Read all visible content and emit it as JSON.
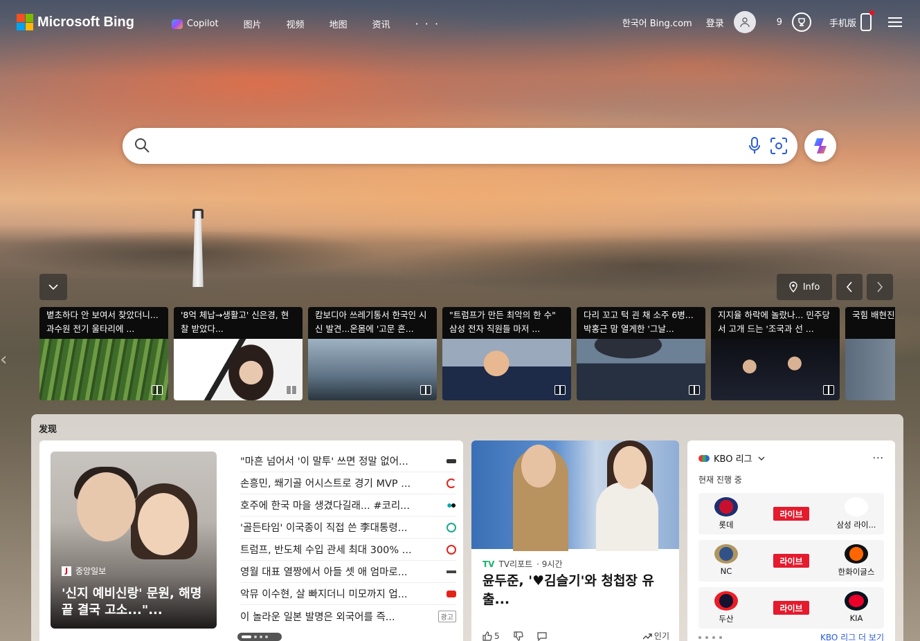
{
  "header": {
    "logo_text": "Microsoft Bing",
    "nav": [
      {
        "label": "Copilot"
      },
      {
        "label": "图片"
      },
      {
        "label": "视频"
      },
      {
        "label": "地图"
      },
      {
        "label": "资讯"
      },
      {
        "label": "· · ·"
      }
    ],
    "region_link": "한국어 Bing.com",
    "login": "登录",
    "reward_count": "9",
    "mobile": "手机版"
  },
  "search": {
    "value": "",
    "placeholder": ""
  },
  "carousel": {
    "info_label": "Info",
    "items": [
      {
        "title": "볕초하다 안 보여서 찾았더니... 과수원 전기 울타리에 ..."
      },
      {
        "title": "'8억 체납→생활고' 신은경, 현찰 받았다..."
      },
      {
        "title": "캄보디아 쓰레기통서 한국인 시신 발견...온몸에 '고문 흔..."
      },
      {
        "title": "\"트럼프가 만든 최악의 한 수\" 삼성 전자 직원들 마저 ..."
      },
      {
        "title": "다리 꼬고 턱 괸 채 소주 6병...박홍근 맘 열게한 '그날..."
      },
      {
        "title": "지지율 하락에 놀랐나... 민주당서 고개 드는 '조국과 선 ..."
      },
      {
        "title": "국힘 배현진 개두술 받아"
      }
    ]
  },
  "discover": {
    "label": "发现",
    "hero": {
      "source": "중앙일보",
      "title": "'신지 예비신랑' 문원, 해명 끝 결국 고소...\"..."
    },
    "headlines": [
      {
        "text": "\"마흔 넘어서 '이 말투' 쓰면 정말 없어..."
      },
      {
        "text": "손흥민, 쐐기골 어시스트로 경기 MVP ..."
      },
      {
        "text": "호주에 한국 마을 생겼다길래... #코리..."
      },
      {
        "text": "'골든타임' 이국종이 직접 쓴 李대통령..."
      },
      {
        "text": "트럼프, 반도체 수입 관세 최대 300% ..."
      },
      {
        "text": "영월 대표 열짱에서 아들 셋 애 엄마로..."
      },
      {
        "text": "악뮤 이수현, 살 빠지더니 미모까지 업..."
      },
      {
        "text": "이 놀라운 일본 발명은 외국어를 즉...",
        "ad": "광고"
      }
    ],
    "feature": {
      "source": "TV리포트",
      "time": "· 9시간",
      "title": "윤두준, '♥김슬기'와 청첩장 유출...",
      "likes": "5",
      "trend": "인기"
    },
    "kbo": {
      "title": "KBO 리그",
      "status": "현재 진행 중",
      "live_label": "라이브",
      "games": [
        {
          "home": "롯데",
          "away": "삼성 라이..."
        },
        {
          "home": "NC",
          "away": "한화이글스"
        },
        {
          "home": "두산",
          "away": "KIA"
        }
      ],
      "more_link": "KBO 리그 더 보기"
    }
  },
  "colors": {
    "accent": "#2a5bd7",
    "live": "#e51a2d"
  }
}
